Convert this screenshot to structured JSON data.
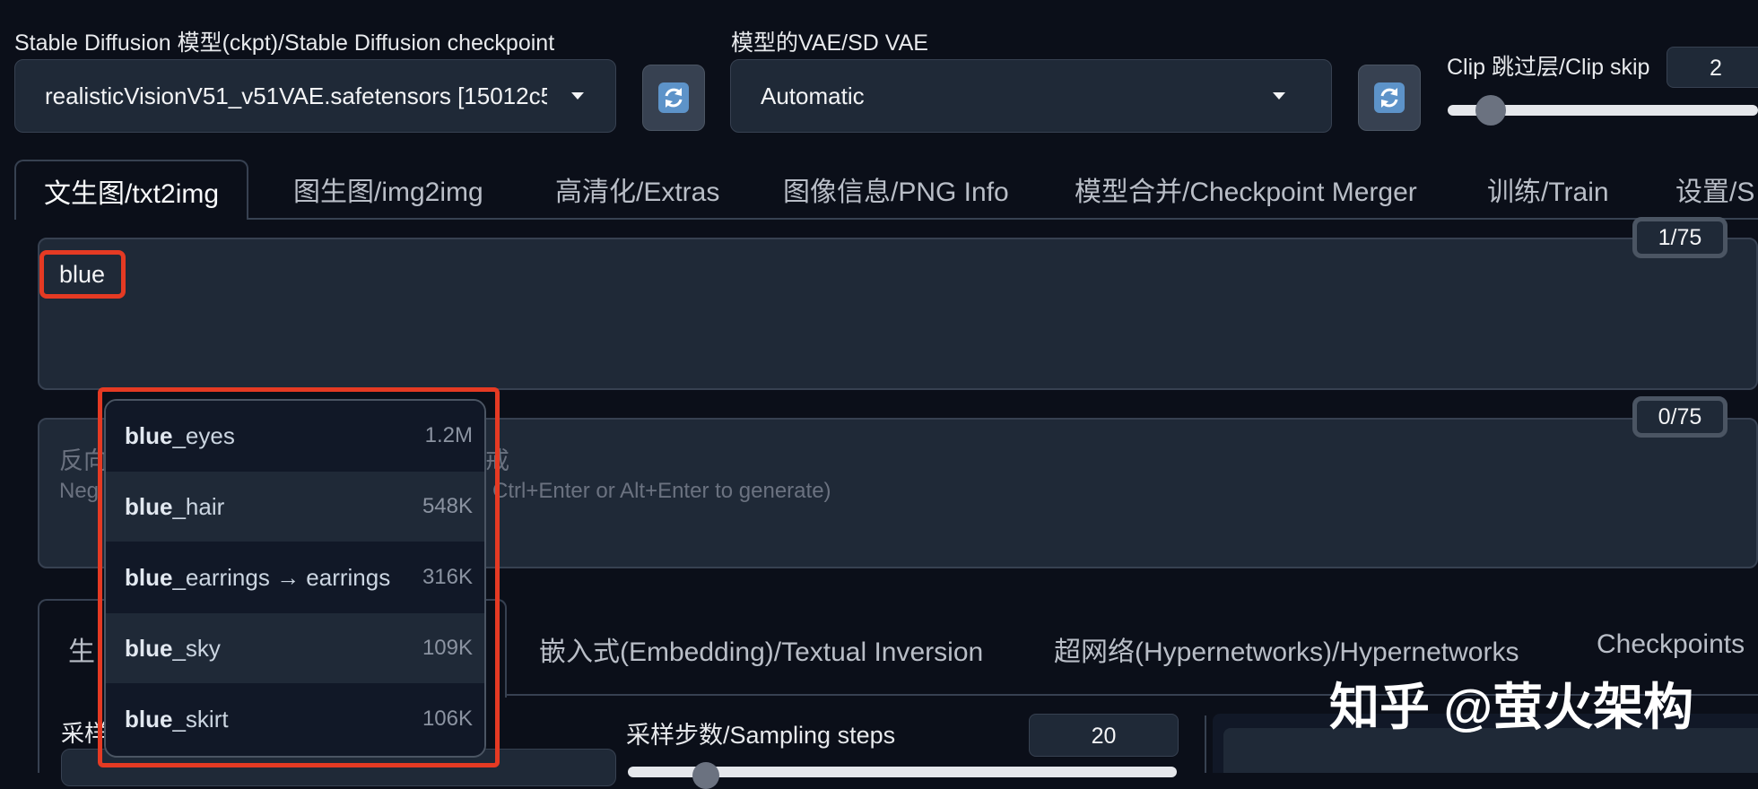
{
  "model": {
    "label": "Stable Diffusion 模型(ckpt)/Stable Diffusion checkpoint",
    "value": "realisticVisionV51_v51VAE.safetensors [15012c5"
  },
  "vae": {
    "label": "模型的VAE/SD VAE",
    "value": "Automatic"
  },
  "clip_skip": {
    "label": "Clip 跳过层/Clip skip",
    "value": "2"
  },
  "tabs": [
    {
      "label": "文生图/txt2img",
      "active": true
    },
    {
      "label": "图生图/img2img"
    },
    {
      "label": "高清化/Extras"
    },
    {
      "label": "图像信息/PNG Info"
    },
    {
      "label": "模型合并/Checkpoint Merger"
    },
    {
      "label": "训练/Train"
    },
    {
      "label": "设置/S"
    }
  ],
  "prompt": {
    "value": "blue",
    "token_counter": "1/75"
  },
  "negative_prompt": {
    "placeholder_line1_start": "反向",
    "placeholder_line1_end": "戒",
    "placeholder_line2_start": "Neg",
    "placeholder_line2_end": "Ctrl+Enter or Alt+Enter to generate)",
    "token_counter": "0/75"
  },
  "autocomplete": [
    {
      "bold": "blue",
      "rest": "_eyes",
      "count": "1.2M"
    },
    {
      "bold": "blue",
      "rest": "_hair",
      "count": "548K"
    },
    {
      "bold": "blue",
      "rest": "_earrings → earrings",
      "count": "316K"
    },
    {
      "bold": "blue",
      "rest": "_sky",
      "count": "109K"
    },
    {
      "bold": "blue",
      "rest": "_skirt",
      "count": "106K"
    }
  ],
  "subtabs": {
    "first_visible": "生",
    "embedding": "嵌入式(Embedding)/Textual Inversion",
    "hypernetworks": "超网络(Hypernetworks)/Hypernetworks",
    "checkpoints": "Checkpoints"
  },
  "sampling": {
    "method_label_partial": "采样",
    "steps_label": "采样步数/Sampling steps",
    "steps_value": "20"
  },
  "watermark": "知乎 @萤火架构",
  "colors": {
    "background": "#0b0f19",
    "panel": "#1f2937",
    "highlight_red": "#e53a23"
  }
}
